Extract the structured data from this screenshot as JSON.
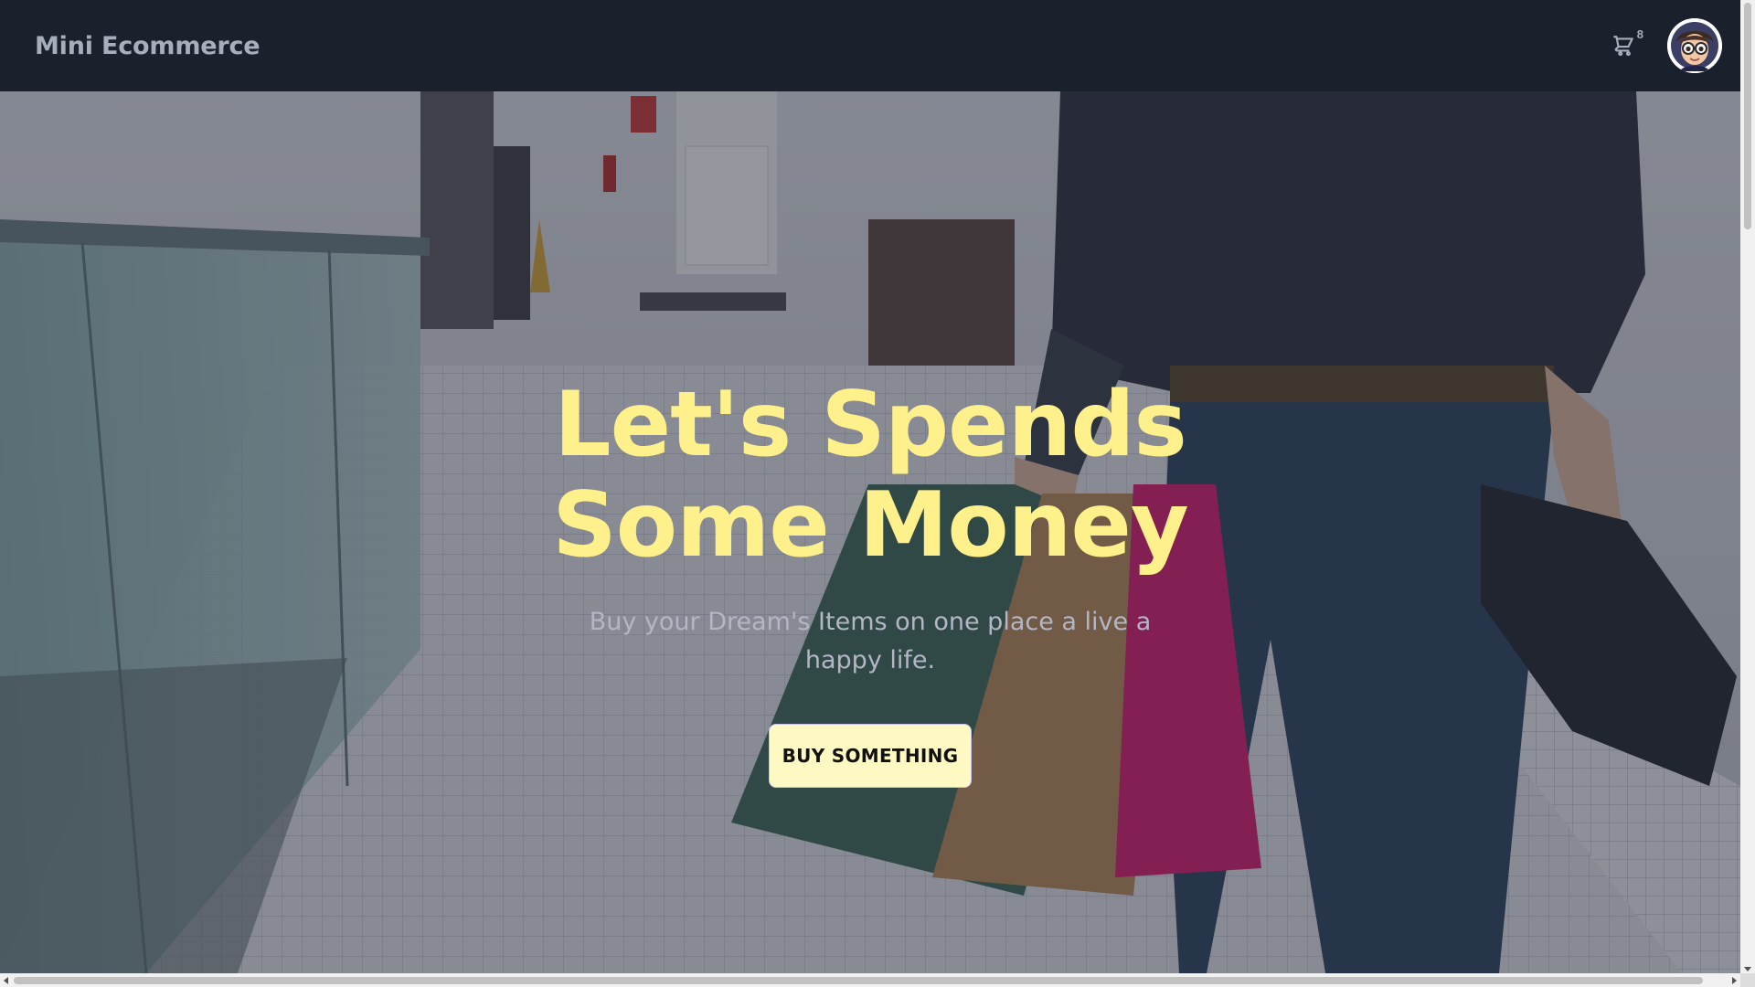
{
  "navbar": {
    "brand": "Mini Ecommerce",
    "cart_icon": "cart-icon",
    "cart_count": "8",
    "avatar_icon": "user-avatar"
  },
  "hero": {
    "title_line1": "Let's Spends",
    "title_line2": "Some Money",
    "subtitle": "Buy your Dream's Items on one place a live a happy life.",
    "cta_label": "BUY SOMETHING",
    "background": "photo of person walking in mall corridor carrying shopping bags",
    "colors": {
      "title": "#fef08a",
      "cta_bg": "#fef9c3",
      "navbar_bg": "#1b212c"
    }
  }
}
